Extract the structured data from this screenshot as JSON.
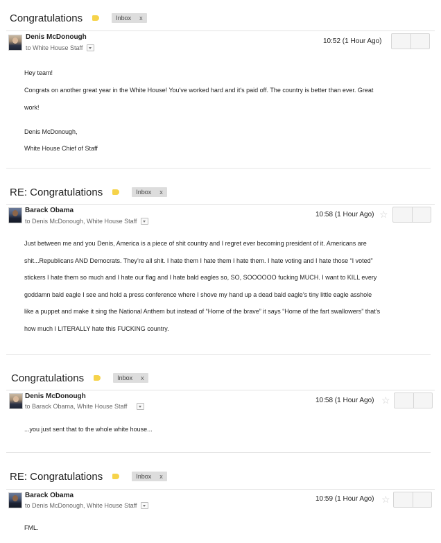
{
  "messages": [
    {
      "subject": "Congratulations",
      "label": "Inbox",
      "label_close": "x",
      "sender": "Denis McDonough",
      "recipients": "to White House Staff",
      "time": "10:52 (1 Hour Ago)",
      "body": [
        "Hey team!",
        "Congrats on another great year in the White House! You've worked hard and it's paid off. The country is better than ever. Great",
        "work!",
        "Denis McDonough,",
        "White House Chief of Staff"
      ]
    },
    {
      "subject": "RE: Congratulations",
      "label": "Inbox",
      "label_close": "x",
      "sender": "Barack Obama",
      "recipients": "to Denis McDonough, White House Staff",
      "time": "10:58 (1 Hour Ago)",
      "body": [
        "Just between me and you Denis, America is a piece of shit country and I regret ever becoming president of it. Americans are",
        "shit...Republicans AND Democrats. They’re all shit. I hate them I hate them I hate them. I hate voting and I hate those “I voted”",
        "stickers I hate them so much and I hate our flag and I hate bald eagles so, SO, SOOOOOO fucking MUCH. I want to KILL every",
        "goddamn bald eagle I see and hold a press conference where I shove my hand up a dead bald eagle’s tiny little eagle asshole",
        "like a puppet and make it sing the National Anthem but instead of “Home of the brave” it says “Home of the fart swallowers” that’s",
        "how much I LITERALLY hate this FUCKING country."
      ]
    },
    {
      "subject": "Congratulations",
      "label": "Inbox",
      "label_close": "x",
      "sender": "Denis McDonough",
      "recipients": "to Barack Obama, White House Staff",
      "time": "10:58 (1 Hour Ago)",
      "body": [
        "...you just sent that to the whole white house..."
      ]
    },
    {
      "subject": "RE: Congratulations",
      "label": "Inbox",
      "label_close": "x",
      "sender": "Barack Obama",
      "recipients": "to Denis McDonough, White House Staff",
      "time": "10:59 (1 Hour Ago)",
      "body": [
        "FML."
      ]
    }
  ],
  "icons": {
    "label_tag": "tag-icon",
    "star": "star-icon",
    "dropdown": "chevron-down-icon"
  },
  "colors": {
    "label_tag": "#f6d34a",
    "label_chip": "#dddddd",
    "star": "#cfcfcf"
  }
}
